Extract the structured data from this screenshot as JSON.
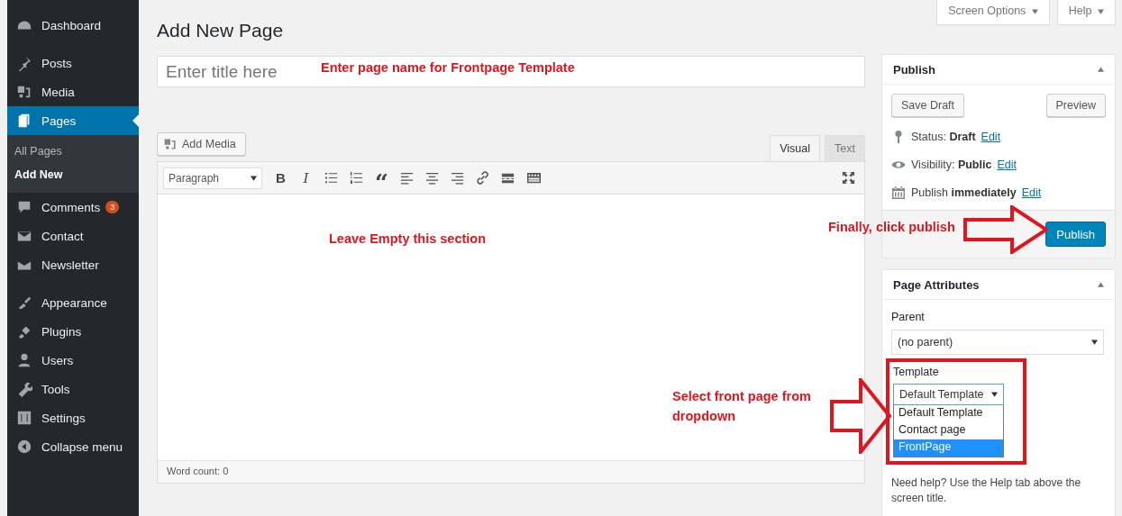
{
  "sidebar": {
    "groups": [
      {
        "items": [
          {
            "label": "Dashboard",
            "selected": false
          }
        ]
      },
      {
        "items": [
          {
            "label": "Posts",
            "selected": false
          },
          {
            "label": "Media",
            "selected": false
          },
          {
            "label": "Pages",
            "selected": true,
            "children": [
              {
                "label": "All Pages",
                "selected": false
              },
              {
                "label": "Add New",
                "selected": true
              }
            ]
          },
          {
            "label": "Comments",
            "selected": false,
            "badge": "3"
          },
          {
            "label": "Contact",
            "selected": false
          },
          {
            "label": "Newsletter",
            "selected": false
          }
        ]
      },
      {
        "items": [
          {
            "label": "Appearance",
            "selected": false
          },
          {
            "label": "Plugins",
            "selected": false
          },
          {
            "label": "Users",
            "selected": false
          },
          {
            "label": "Tools",
            "selected": false
          },
          {
            "label": "Settings",
            "selected": false
          },
          {
            "label": "Collapse menu",
            "selected": false
          }
        ]
      }
    ]
  },
  "top_tabs": [
    "Screen Options",
    "Help"
  ],
  "page_title": "Add New Page",
  "title_field": {
    "placeholder": "Enter title here"
  },
  "add_media": "Add Media",
  "editor_tabs": [
    {
      "label": "Visual",
      "selected": true
    },
    {
      "label": "Text",
      "selected": false
    }
  ],
  "toolbar": {
    "format": "Paragraph",
    "buttons": [
      {
        "kind": "bold",
        "label": "B"
      },
      {
        "kind": "italic",
        "label": "I"
      },
      {
        "kind": "bullet-list"
      },
      {
        "kind": "numbered-list"
      },
      {
        "kind": "quote",
        "label": "“"
      },
      {
        "kind": "align-left"
      },
      {
        "kind": "align-center"
      },
      {
        "kind": "align-right"
      },
      {
        "kind": "link"
      },
      {
        "kind": "read-more"
      },
      {
        "kind": "toolbar-toggle"
      }
    ]
  },
  "word_count": "Word count: 0",
  "publish": {
    "title": "Publish",
    "save_draft": "Save Draft",
    "preview": "Preview",
    "rows": [
      {
        "kind": "status",
        "label": "Status:",
        "value": "Draft",
        "link": "Edit"
      },
      {
        "kind": "visibility",
        "label": "Visibility:",
        "value": "Public",
        "link": "Edit"
      },
      {
        "kind": "schedule",
        "label": "Publish",
        "value": "immediately",
        "link": "Edit"
      }
    ],
    "button": "Publish"
  },
  "page_attributes": {
    "title": "Page Attributes",
    "parent_label": "Parent",
    "parent_value": "(no parent)",
    "template_label": "Template",
    "template_value": "Default Template",
    "template_options": [
      {
        "label": "Default Template",
        "selected": false
      },
      {
        "label": "Contact page",
        "selected": false
      },
      {
        "label": "FrontPage",
        "selected": true
      }
    ],
    "help": "Need help? Use the Help tab above the screen title."
  },
  "annotations": [
    "Enter page name for Frontpage Template",
    "Leave Empty this section",
    "Finally, click publish",
    "Select front page from dropdown"
  ]
}
